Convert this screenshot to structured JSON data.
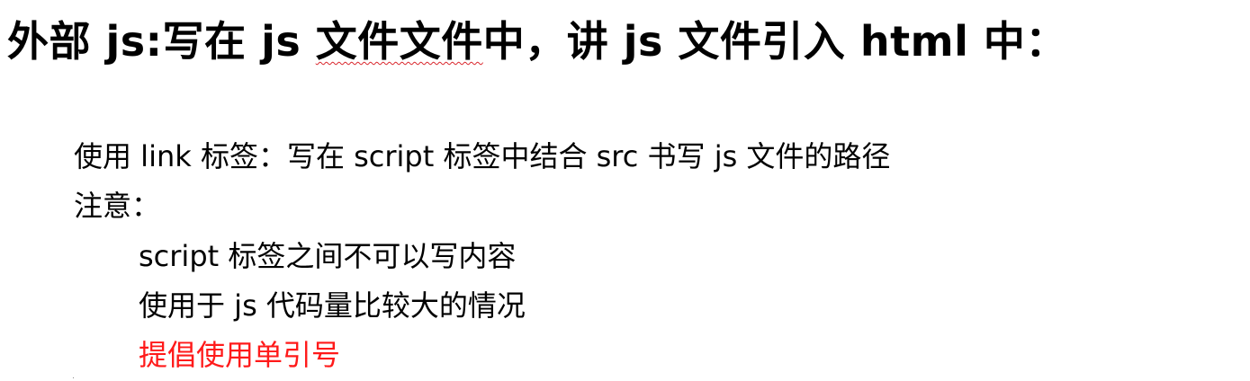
{
  "heading": {
    "prefix": "外部 js:写在 js ",
    "squiggle_text": "文件文件",
    "suffix": "中，讲 js 文件引入 html 中："
  },
  "body": {
    "line1": "使用 link 标签：写在 script 标签中结合 src 书写 js 文件的路径",
    "line2": "注意：",
    "notes": [
      "script 标签之间不可以写内容",
      "使用于 js 代码量比较大的情况",
      "提倡使用单引号"
    ]
  },
  "colors": {
    "text": "#000000",
    "highlight": "#ff1a1a",
    "spellcheck": "#d9262c"
  }
}
